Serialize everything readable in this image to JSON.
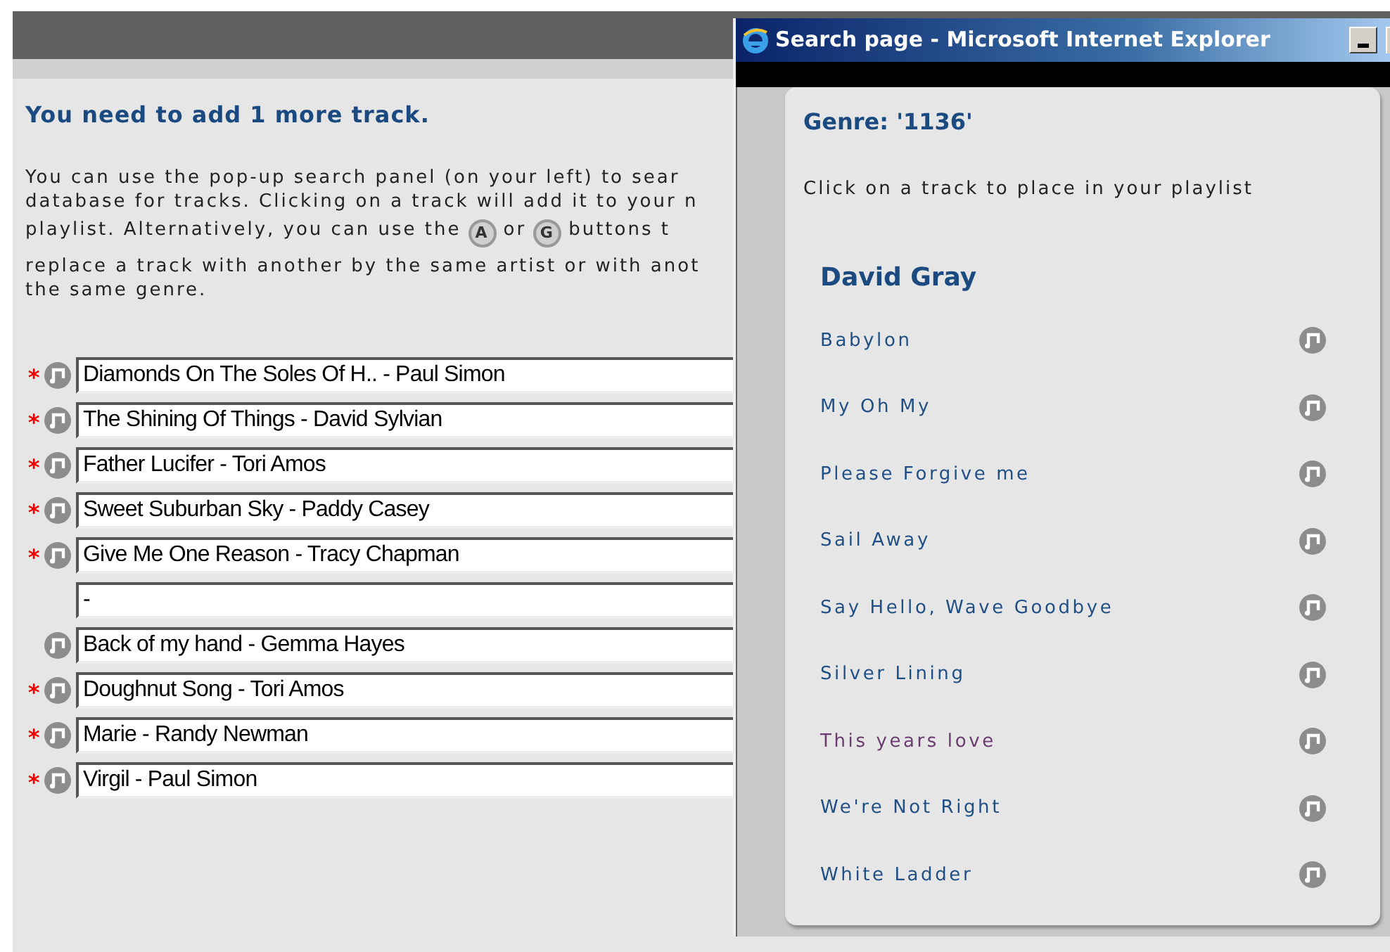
{
  "heading": "You need to add 1 more track.",
  "intro": {
    "line_1": "You can use the pop-up search panel (on your left) to sear",
    "line_2": "database for tracks. Clicking on a track will add it to your n",
    "line_3_start": "playlist. Alternatively, you can use the",
    "artist_button": "A",
    "line_3_middle": "or",
    "genre_button": "G",
    "line_3_end": "buttons t",
    "line_4": "replace a track with another by the same artist or with anot",
    "line_5": "the same genre."
  },
  "required_marker": "*",
  "playlist": [
    {
      "value": "Diamonds On The Soles Of H.. - Paul Simon",
      "required": true,
      "replace_button": true
    },
    {
      "value": "The Shining Of Things - David Sylvian",
      "required": true,
      "replace_button": true
    },
    {
      "value": "Father Lucifer - Tori Amos",
      "required": true,
      "replace_button": true
    },
    {
      "value": "Sweet Suburban Sky - Paddy Casey",
      "required": true,
      "replace_button": true
    },
    {
      "value": "Give Me One Reason - Tracy Chapman",
      "required": true,
      "replace_button": true
    },
    {
      "value": "-",
      "required": false,
      "replace_button": false
    },
    {
      "value": "Back of my hand - Gemma Hayes",
      "required": false,
      "replace_button": true
    },
    {
      "value": "Doughnut Song - Tori Amos",
      "required": true,
      "replace_button": true
    },
    {
      "value": "Marie - Randy Newman",
      "required": true,
      "replace_button": true
    },
    {
      "value": "Virgil - Paul Simon",
      "required": true,
      "replace_button": true
    }
  ],
  "popup": {
    "window": {
      "title": "Search page - Microsoft Internet Explorer"
    },
    "genre_title": "Genre: '1136'",
    "instruction": "Click on a track to place in your playlist",
    "artist": "David Gray",
    "tracks": [
      {
        "title": "Babylon",
        "visited": false
      },
      {
        "title": "My Oh My",
        "visited": false
      },
      {
        "title": "Please Forgive me",
        "visited": false
      },
      {
        "title": "Sail Away",
        "visited": false
      },
      {
        "title": "Say Hello, Wave Goodbye",
        "visited": false
      },
      {
        "title": "Silver Lining",
        "visited": false
      },
      {
        "title": "This years love",
        "visited": true
      },
      {
        "title": "We're Not Right",
        "visited": false
      },
      {
        "title": "White Ladder",
        "visited": false
      }
    ]
  }
}
